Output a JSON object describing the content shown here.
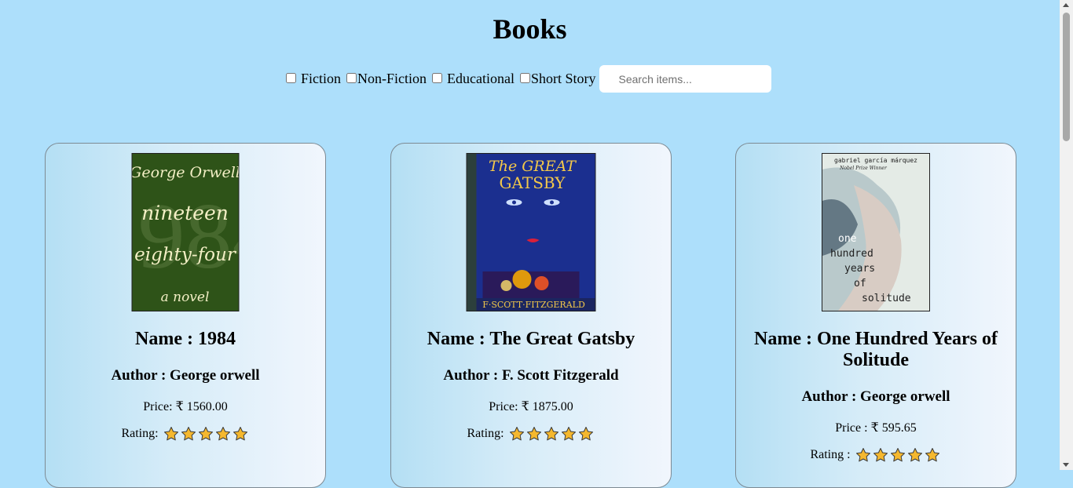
{
  "page": {
    "title": "Books"
  },
  "filters": [
    {
      "label": "Fiction",
      "checked": false
    },
    {
      "label": "Non-Fiction",
      "checked": false
    },
    {
      "label": "Educational",
      "checked": false
    },
    {
      "label": "Short Story",
      "checked": false
    }
  ],
  "search": {
    "placeholder": "Search items...",
    "value": ""
  },
  "books": [
    {
      "name": "Name : 1984",
      "author": "Author : George orwell",
      "price": "Price: ₹ 1560.00",
      "rating_label": "Rating:",
      "rating": 5,
      "cover": {
        "title": "nineteen eighty-four",
        "author": "George Orwell",
        "subtitle": "a novel",
        "background": "#2e5318"
      }
    },
    {
      "name": "Name : The Great Gatsby",
      "author": "Author : F. Scott Fitzgerald",
      "price": "Price: ₹ 1875.00",
      "rating_label": "Rating:",
      "rating": 5,
      "cover": {
        "title": "The GREAT GATSBY",
        "author": "F·SCOTT·FITZGERALD",
        "background": "#1b2f8f"
      }
    },
    {
      "name": "Name : One Hundred Years of Solitude",
      "author": "Author : George orwell",
      "price": "Price : ₹ 595.65",
      "rating_label": "Rating :",
      "rating": 5,
      "cover": {
        "title": "one hundred years of solitude",
        "author": "gabriel garcía márquez",
        "subtitle": "Nobel Prize Winner",
        "background": "#e4ebe6"
      }
    }
  ],
  "colors": {
    "background": "#addffb",
    "star": "#f5b82e"
  }
}
